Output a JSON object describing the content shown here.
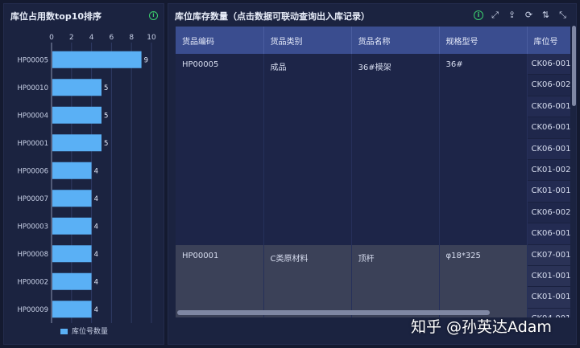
{
  "left": {
    "title": "库位占用数top10排序",
    "legend": "库位号数量"
  },
  "chart_data": {
    "type": "bar",
    "orientation": "horizontal",
    "categories": [
      "HP00005",
      "HP00010",
      "HP00004",
      "HP00001",
      "HP00006",
      "HP00007",
      "HP00003",
      "HP00008",
      "HP00002",
      "HP00009"
    ],
    "values": [
      9,
      5,
      5,
      5,
      4,
      4,
      4,
      4,
      4,
      4
    ],
    "xlim": [
      0,
      10
    ],
    "xticks": [
      "0",
      "2",
      "4",
      "6",
      "8",
      "10"
    ],
    "legend": [
      "库位号数量"
    ],
    "legend_position": "bottom",
    "bar_color": "#5ab0f5",
    "grid": true
  },
  "right": {
    "title": "库位库存数量（点击数据可联动查询出入库记录）",
    "toolbar": [
      "info-icon",
      "link-icon",
      "export-icon",
      "refresh-icon",
      "sort-icon",
      "collapse-icon"
    ],
    "columns": [
      "货品编码",
      "货品类别",
      "货品名称",
      "规格型号",
      "库位号"
    ],
    "groups": [
      {
        "code": "HP00005",
        "category": "成品",
        "name": "36#模架",
        "spec": "36#",
        "locations": [
          "CK06-001",
          "CK06-002",
          "CK06-001",
          "CK06-001",
          "CK06-001",
          "CK01-002",
          "CK01-001",
          "CK06-002",
          "CK06-001"
        ]
      },
      {
        "code": "HP00001",
        "category": "C类原材料",
        "name": "顶杆",
        "spec": "φ18*325",
        "locations": [
          "CK07-001",
          "CK01-001",
          "CK01-001",
          "CK04-001"
        ]
      }
    ]
  },
  "watermark": "知乎 @孙英达Adam"
}
